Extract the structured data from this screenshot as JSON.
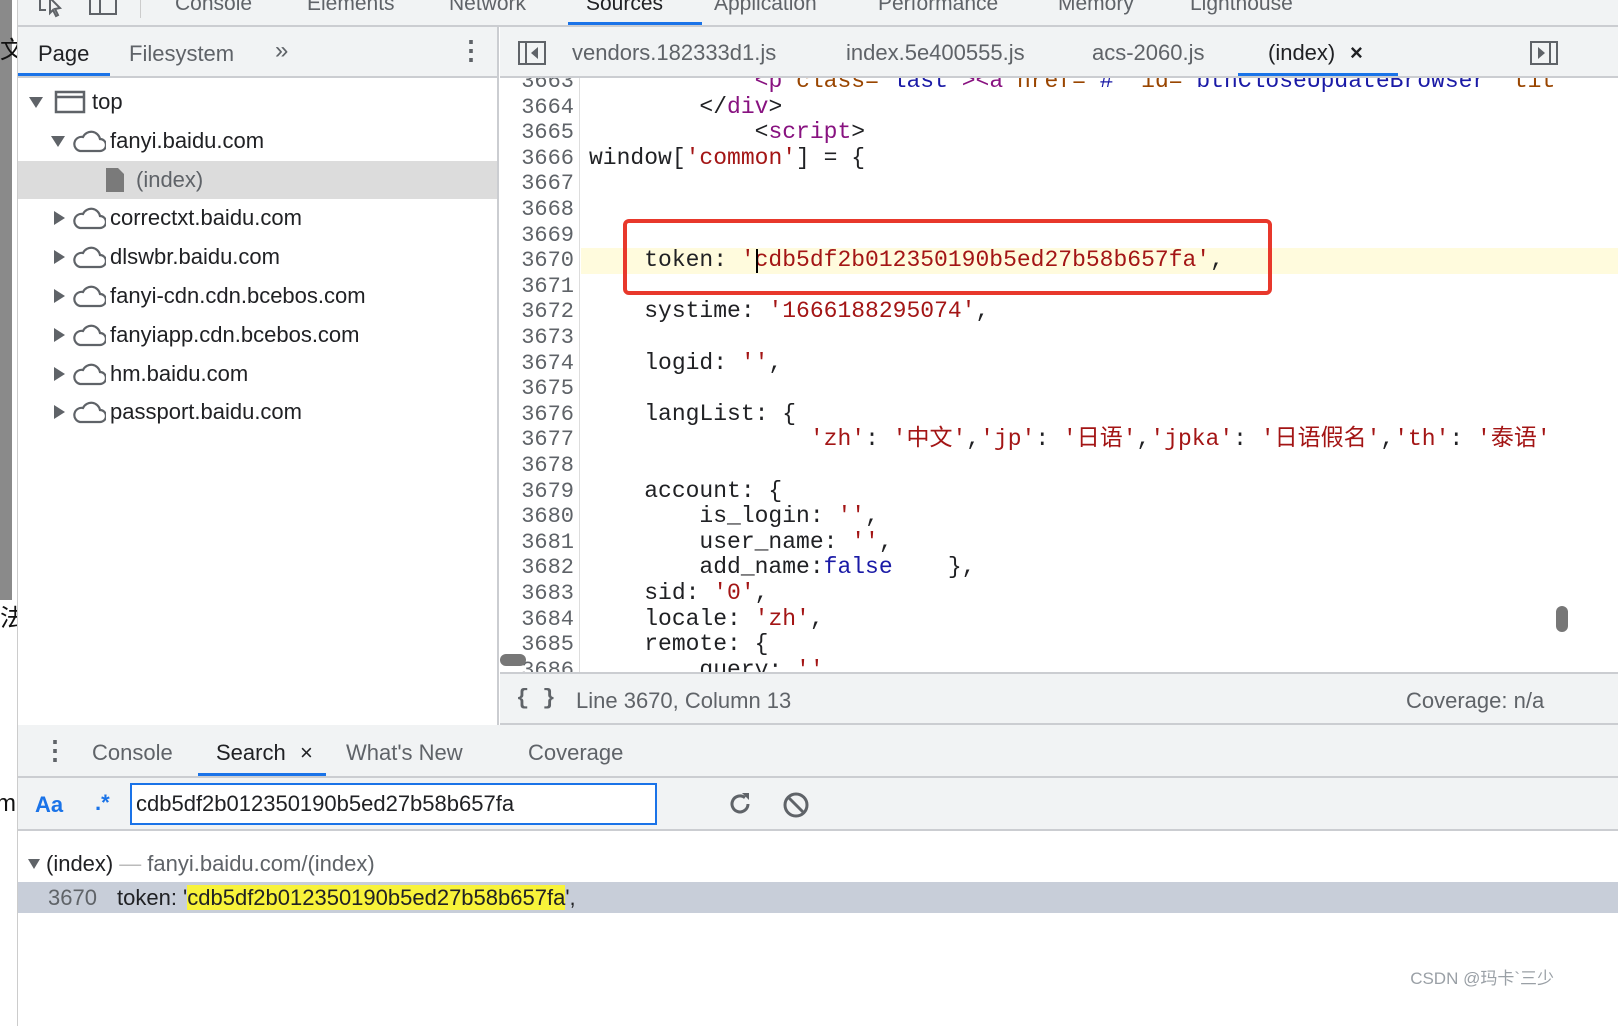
{
  "left_strip": {
    "glyphs": [
      "文",
      "法",
      "ma"
    ]
  },
  "devtools_tabs": [
    {
      "label": "Console"
    },
    {
      "label": "Elements"
    },
    {
      "label": "Network"
    },
    {
      "label": "Sources",
      "active": true
    },
    {
      "label": "Application"
    },
    {
      "label": "Performance"
    },
    {
      "label": "Memory"
    },
    {
      "label": "Lighthouse"
    }
  ],
  "navigator": {
    "tabs": [
      {
        "label": "Page",
        "active": true
      },
      {
        "label": "Filesystem"
      }
    ],
    "more_icon": "chevron-double-right-icon",
    "tree": [
      {
        "label": "top",
        "type": "frame",
        "expanded": true,
        "depth": 0
      },
      {
        "label": "fanyi.baidu.com",
        "type": "domain",
        "expanded": true,
        "depth": 1
      },
      {
        "label": "(index)",
        "type": "file",
        "selected": true,
        "depth": 2
      },
      {
        "label": "correctxt.baidu.com",
        "type": "domain",
        "depth": 1
      },
      {
        "label": "dlswbr.baidu.com",
        "type": "domain",
        "depth": 1
      },
      {
        "label": "fanyi-cdn.cdn.bcebos.com",
        "type": "domain",
        "depth": 1
      },
      {
        "label": "fanyiapp.cdn.bcebos.com",
        "type": "domain",
        "depth": 1
      },
      {
        "label": "hm.baidu.com",
        "type": "domain",
        "depth": 1
      },
      {
        "label": "passport.baidu.com",
        "type": "domain",
        "depth": 1
      }
    ]
  },
  "editor": {
    "tabs": [
      {
        "label": "vendors.182333d1.js"
      },
      {
        "label": "index.5e400555.js"
      },
      {
        "label": "acs-2060.js"
      },
      {
        "label": "(index)",
        "active": true,
        "closable": true
      }
    ],
    "close_glyph": "×",
    "highlighted_line": 3670,
    "lines": [
      {
        "n": "3663",
        "t": [
          [
            "            ",
            ""
          ],
          [
            "<p ",
            "tag"
          ],
          [
            "class=",
            "attr"
          ],
          [
            "\"last\"",
            "attrv"
          ],
          [
            "><",
            "tag"
          ],
          [
            "a ",
            "tag"
          ],
          [
            "href=",
            "attr"
          ],
          [
            "\"#\" ",
            "attrv"
          ],
          [
            "id=",
            "attr"
          ],
          [
            "\"btnCloseUpdateBrowser\" ",
            "attrv"
          ],
          [
            "tit",
            "attr"
          ]
        ]
      },
      {
        "n": "3664",
        "t": [
          [
            "        </",
            ""
          ],
          [
            "div",
            "tag"
          ],
          [
            ">",
            ""
          ]
        ]
      },
      {
        "n": "3665",
        "t": [
          [
            "            <",
            ""
          ],
          [
            "script",
            "tag"
          ],
          [
            ">",
            ""
          ]
        ]
      },
      {
        "n": "3666",
        "t": [
          [
            "window[",
            ""
          ],
          [
            "'common'",
            "str"
          ],
          [
            "] = {",
            ""
          ]
        ]
      },
      {
        "n": "3667",
        "t": []
      },
      {
        "n": "3668",
        "t": []
      },
      {
        "n": "3669",
        "t": []
      },
      {
        "n": "3670",
        "t": [
          [
            "    token: ",
            ""
          ],
          [
            "'cdb5df2b012350190b5ed27b58b657fa'",
            "str"
          ],
          [
            ",",
            ""
          ]
        ]
      },
      {
        "n": "3671",
        "t": []
      },
      {
        "n": "3672",
        "t": [
          [
            "    systime: ",
            ""
          ],
          [
            "'1666188295074'",
            "str"
          ],
          [
            ",",
            ""
          ]
        ]
      },
      {
        "n": "3673",
        "t": []
      },
      {
        "n": "3674",
        "t": [
          [
            "    logid: ",
            ""
          ],
          [
            "''",
            "str"
          ],
          [
            ",",
            ""
          ]
        ]
      },
      {
        "n": "3675",
        "t": []
      },
      {
        "n": "3676",
        "t": [
          [
            "    langList: {",
            ""
          ]
        ]
      },
      {
        "n": "3677",
        "t": [
          [
            "                ",
            ""
          ],
          [
            "'zh'",
            "str"
          ],
          [
            ": ",
            ""
          ],
          [
            "'中文'",
            "str"
          ],
          [
            ",",
            ""
          ],
          [
            "'jp'",
            "str"
          ],
          [
            ": ",
            ""
          ],
          [
            "'日语'",
            "str"
          ],
          [
            ",",
            ""
          ],
          [
            "'jpka'",
            "str"
          ],
          [
            ": ",
            ""
          ],
          [
            "'日语假名'",
            "str"
          ],
          [
            ",",
            ""
          ],
          [
            "'th'",
            "str"
          ],
          [
            ": ",
            ""
          ],
          [
            "'泰语'",
            "str"
          ]
        ]
      },
      {
        "n": "3678",
        "t": []
      },
      {
        "n": "3679",
        "t": [
          [
            "    account: {",
            ""
          ]
        ]
      },
      {
        "n": "3680",
        "t": [
          [
            "        is_login: ",
            ""
          ],
          [
            "''",
            "str"
          ],
          [
            ",",
            ""
          ]
        ]
      },
      {
        "n": "3681",
        "t": [
          [
            "        user_name: ",
            ""
          ],
          [
            "''",
            "str"
          ],
          [
            ",",
            ""
          ]
        ]
      },
      {
        "n": "3682",
        "t": [
          [
            "        add_name:",
            ""
          ],
          [
            "false",
            "kw"
          ],
          [
            "    },",
            ""
          ]
        ]
      },
      {
        "n": "3683",
        "t": [
          [
            "    sid: ",
            ""
          ],
          [
            "'0'",
            "str"
          ],
          [
            ",",
            ""
          ]
        ]
      },
      {
        "n": "3684",
        "t": [
          [
            "    locale: ",
            ""
          ],
          [
            "'zh'",
            "str"
          ],
          [
            ",",
            ""
          ]
        ]
      },
      {
        "n": "3685",
        "t": [
          [
            "    remote: {",
            ""
          ]
        ]
      },
      {
        "n": "3686",
        "t": [
          [
            "        query: ",
            ""
          ],
          [
            "''",
            "str"
          ]
        ]
      }
    ]
  },
  "status": {
    "format_icon": "{ }",
    "position": "Line 3670, Column 13",
    "coverage": "Coverage: n/a"
  },
  "drawer": {
    "tabs": [
      {
        "label": "Console"
      },
      {
        "label": "Search",
        "active": true,
        "closable": true
      },
      {
        "label": "What's New"
      },
      {
        "label": "Coverage"
      }
    ],
    "close_glyph": "×"
  },
  "search": {
    "match_case_label": "Aa",
    "regex_label": ".*",
    "query": "cdb5df2b012350190b5ed27b58b657fa",
    "refresh_icon": "refresh-icon",
    "clear_icon": "clear-icon"
  },
  "results": {
    "file": "(index)",
    "separator": "—",
    "url": "fanyi.baidu.com/(index)",
    "matches": [
      {
        "line": "3670",
        "prefix": "token: '",
        "match": "cdb5df2b012350190b5ed27b58b657fa",
        "suffix": "',"
      }
    ]
  },
  "watermark": "CSDN @玛卡`三少",
  "colors": {
    "accent": "#1a73e8",
    "highlight_box": "#e8382b",
    "string": "#a31515",
    "match": "#f8f33a"
  }
}
